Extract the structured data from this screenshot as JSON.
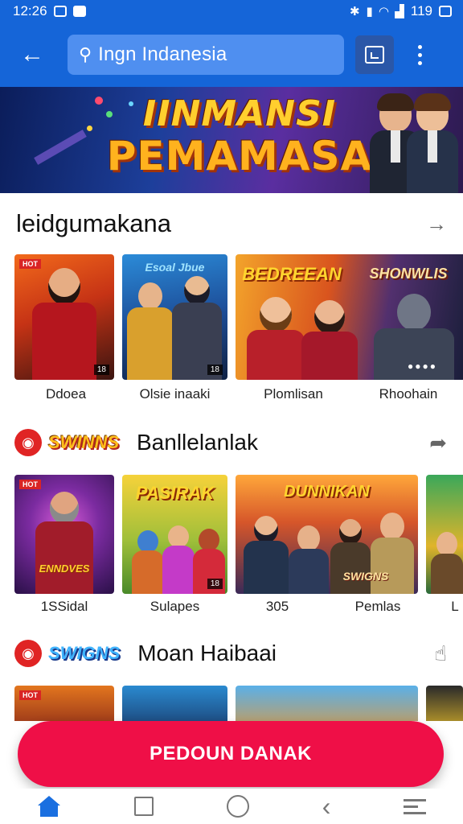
{
  "status_bar": {
    "time": "12:26",
    "battery": "119"
  },
  "app_bar": {
    "search_query": "Ingn Indanesia"
  },
  "hero": {
    "title_line1": "IINMANSI",
    "title_line2": "PEMAMASA"
  },
  "sections": [
    {
      "title": "leidgumakana",
      "cards": [
        {
          "caption": "Ddoea",
          "tag": "",
          "badge": ""
        },
        {
          "caption": "Olsie inaaki",
          "art_text": "Esoal Jbue",
          "badge": ""
        },
        {
          "caption": "Plomlisan",
          "art_text": "BEDREEAN"
        },
        {
          "caption": "Rhoohain",
          "art_text": "SHONWLIS"
        }
      ]
    },
    {
      "title": "Banllelanlak",
      "logo_text": "SWINNS",
      "cards": [
        {
          "caption": "1SSidal",
          "art_text": "ENNDVES"
        },
        {
          "caption": "Sulapes",
          "art_text": "PASIRAK"
        },
        {
          "caption": "305",
          "art_text": "DUNNIKAN"
        },
        {
          "caption": "Pemlas"
        },
        {
          "caption": "L"
        }
      ]
    },
    {
      "title": "Moan Haibaai",
      "logo_text": "SWIGNS"
    }
  ],
  "cta": {
    "label": "PEDOUN DANAK"
  },
  "colors": {
    "primary": "#1565d8",
    "cta": "#ef0f47",
    "nav_active": "#1a6fe0"
  }
}
